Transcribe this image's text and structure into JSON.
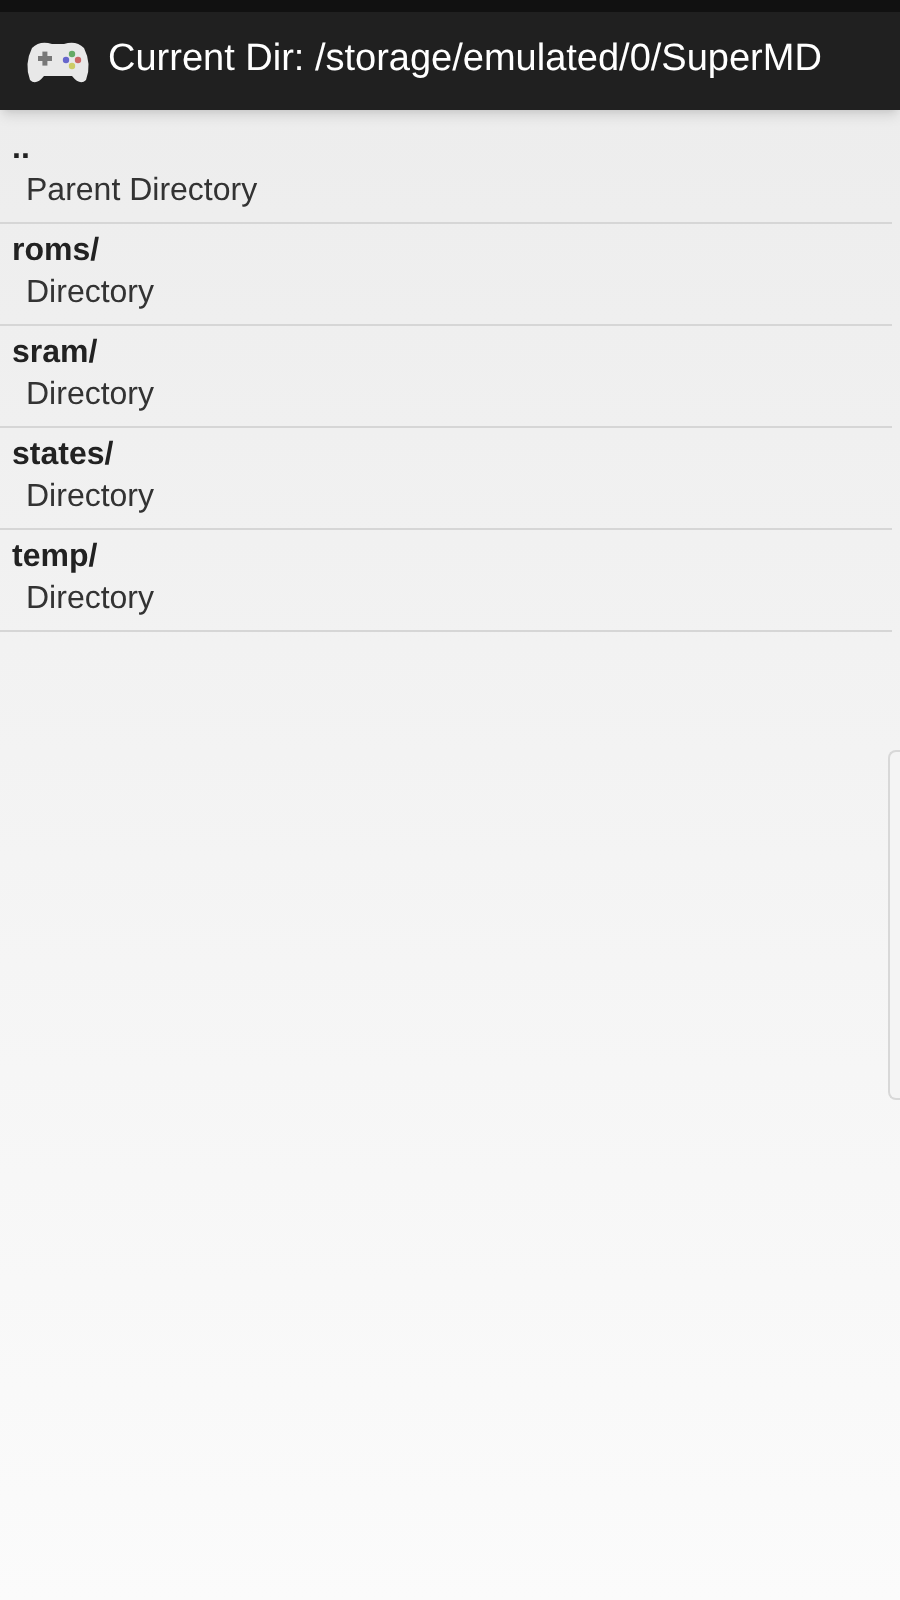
{
  "title_bar": {
    "title": "Current Dir: /storage/emulated/0/SuperMD"
  },
  "entries": [
    {
      "name": "..",
      "description": "Parent Directory"
    },
    {
      "name": "roms/",
      "description": "Directory"
    },
    {
      "name": "sram/",
      "description": "Directory"
    },
    {
      "name": "states/",
      "description": "Directory"
    },
    {
      "name": "temp/",
      "description": "Directory"
    }
  ]
}
